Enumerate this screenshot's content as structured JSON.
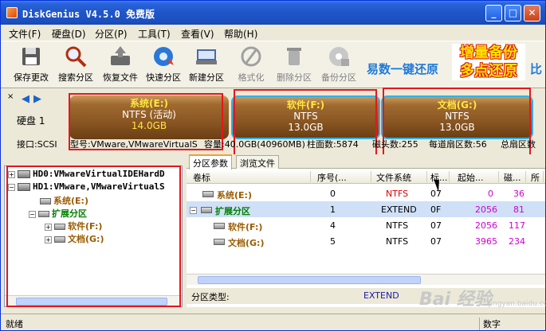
{
  "window": {
    "title": "DiskGenius V4.5.0 免费版",
    "buttons": {
      "minimize": "_",
      "maximize": "□",
      "close": "✕"
    }
  },
  "menu": [
    "文件(F)",
    "硬盘(D)",
    "分区(P)",
    "工具(T)",
    "查看(V)",
    "帮助(H)"
  ],
  "toolbar": {
    "items": [
      {
        "label": "保存更改",
        "icon": "floppy-icon",
        "enabled": true
      },
      {
        "label": "搜索分区",
        "icon": "magnifier-icon",
        "enabled": true
      },
      {
        "label": "恢复文件",
        "icon": "recover-files-icon",
        "enabled": true
      },
      {
        "label": "快速分区",
        "icon": "quick-partition-icon",
        "enabled": true
      },
      {
        "label": "新建分区",
        "icon": "new-partition-icon",
        "enabled": true
      },
      {
        "label": "格式化",
        "icon": "format-icon",
        "enabled": false
      },
      {
        "label": "删除分区",
        "icon": "delete-partition-icon",
        "enabled": false
      },
      {
        "label": "备份分区",
        "icon": "backup-partition-icon",
        "enabled": false
      }
    ],
    "promo_left": "易数一键还原",
    "promo_main_1": "增量备份",
    "promo_main_2": "多点还原",
    "promo_right": "比"
  },
  "diskbar": {
    "disk_label": "硬盘 1",
    "close_glyph": "×",
    "partitions": [
      {
        "name": "系统(E:)",
        "fs": "NTFS (活动)",
        "size": "14.0GB"
      },
      {
        "name": "软件(F:)",
        "fs": "NTFS",
        "size": "13.0GB"
      },
      {
        "name": "文档(G:)",
        "fs": "NTFS",
        "size": "13.0GB"
      }
    ],
    "info": {
      "interface": "接口:SCSI",
      "model": "型号:VMware,VMwareVirtualS",
      "capacity": "容量:40.0GB(40960MB)",
      "cylinders": "柱面数:5874",
      "heads": "磁头数:255",
      "sectors_per_track": "每道扇区数:56",
      "total_sectors": "总扇区数"
    }
  },
  "tree": {
    "hd0": "HD0:VMwareVirtualIDEHardD",
    "hd1": "HD1:VMware,VMwareVirtualS",
    "sys": "系统(E:)",
    "ext": "扩展分区",
    "soft": "软件(F:)",
    "doc": "文档(G:)"
  },
  "tabs": [
    "分区参数",
    "浏览文件"
  ],
  "columns": [
    "卷标",
    "序号(...",
    "文件系统",
    "标...",
    "起始...",
    "磁...",
    "所"
  ],
  "rows": [
    {
      "label": "系统(E:)",
      "index": "0",
      "fs": "NTFS",
      "id": "07",
      "start": "0",
      "head": "36",
      "type": "primary"
    },
    {
      "label": "扩展分区",
      "index": "1",
      "fs": "EXTEND",
      "id": "0F",
      "start": "2056",
      "head": "81",
      "type": "extended"
    },
    {
      "label": "软件(F:)",
      "index": "4",
      "fs": "NTFS",
      "id": "07",
      "start": "2056",
      "head": "117",
      "type": "logical"
    },
    {
      "label": "文档(G:)",
      "index": "5",
      "fs": "NTFS",
      "id": "07",
      "start": "3965",
      "head": "234",
      "type": "logical"
    }
  ],
  "ptype": {
    "label": "分区类型:",
    "value": "EXTEND"
  },
  "status": {
    "left": "就绪",
    "right": "数字"
  },
  "watermark": {
    "main": "Bai 经验",
    "sub": "jingyan.baidu.com"
  },
  "colors": {
    "title_blue": "#1f55c8",
    "partition_brown": "#8a5622",
    "highlight_yellow": "#ffe640",
    "red_fs": "#e00000",
    "ext_green": "#008000"
  }
}
